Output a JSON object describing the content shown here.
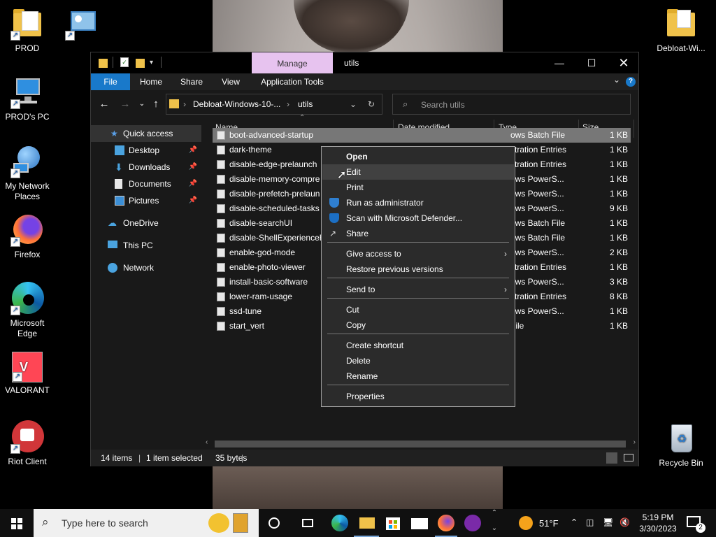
{
  "desktop": {
    "icons_left": [
      {
        "label": "PROD"
      },
      {
        "label": "PROD's PC"
      },
      {
        "label": "My Network Places"
      },
      {
        "label": "Firefox"
      },
      {
        "label": "Microsoft Edge"
      },
      {
        "label": "VALORANT"
      },
      {
        "label": "Riot Client"
      }
    ],
    "icons_right": [
      {
        "label": "Debloat-Wi..."
      },
      {
        "label": "Recycle Bin"
      }
    ]
  },
  "window": {
    "title": "utils",
    "manage_tab": "Manage",
    "ribbon_tabs": [
      "File",
      "Home",
      "Share",
      "View",
      "Application Tools"
    ],
    "help_label": "?",
    "address": {
      "segments": [
        "Debloat-Windows-10-...",
        "utils"
      ]
    },
    "search": {
      "placeholder": "Search utils"
    },
    "nav": {
      "quick_access": "Quick access",
      "items": [
        {
          "label": "Desktop",
          "pinned": true
        },
        {
          "label": "Downloads",
          "pinned": true
        },
        {
          "label": "Documents",
          "pinned": true
        },
        {
          "label": "Pictures",
          "pinned": true
        }
      ],
      "onedrive": "OneDrive",
      "thispc": "This PC",
      "network": "Network"
    },
    "columns": {
      "name": "Name",
      "date": "Date modified",
      "type": "Type",
      "size": "Size"
    },
    "files": [
      {
        "name": "boot-advanced-startup",
        "type": "ows Batch File",
        "size": "1 KB",
        "selected": true
      },
      {
        "name": "dark-theme",
        "type": "stration Entries",
        "size": "1 KB"
      },
      {
        "name": "disable-edge-prelaunch",
        "type": "stration Entries",
        "size": "1 KB"
      },
      {
        "name": "disable-memory-compre",
        "type": "ows PowerS...",
        "size": "1 KB"
      },
      {
        "name": "disable-prefetch-prelaun",
        "type": "ows PowerS...",
        "size": "1 KB"
      },
      {
        "name": "disable-scheduled-tasks",
        "type": "ows PowerS...",
        "size": "9 KB"
      },
      {
        "name": "disable-searchUI",
        "type": "ows Batch File",
        "size": "1 KB"
      },
      {
        "name": "disable-ShellExperienceH",
        "type": "ows Batch File",
        "size": "1 KB"
      },
      {
        "name": "enable-god-mode",
        "type": "ows PowerS...",
        "size": "2 KB"
      },
      {
        "name": "enable-photo-viewer",
        "type": "stration Entries",
        "size": "1 KB"
      },
      {
        "name": "install-basic-software",
        "type": "ows PowerS...",
        "size": "3 KB"
      },
      {
        "name": "lower-ram-usage",
        "type": "stration Entries",
        "size": "8 KB"
      },
      {
        "name": "ssd-tune",
        "type": "ows PowerS...",
        "size": "1 KB"
      },
      {
        "name": "start_vert",
        "type": "File",
        "size": "1 KB"
      }
    ],
    "status": {
      "items": "14 items",
      "selected": "1 item selected",
      "bytes": "35 bytes"
    }
  },
  "context_menu": {
    "items": [
      {
        "label": "Open",
        "bold": true
      },
      {
        "label": "Edit",
        "hover": true
      },
      {
        "label": "Print"
      },
      {
        "label": "Run as administrator",
        "icon": "shield-icon"
      },
      {
        "label": "Scan with Microsoft Defender...",
        "icon": "defender-icon"
      },
      {
        "label": "Share",
        "icon": "share-icon"
      },
      {
        "label": "Give access to",
        "submenu": true
      },
      {
        "label": "Restore previous versions"
      },
      {
        "label": "Send to",
        "submenu": true
      },
      {
        "label": "Cut"
      },
      {
        "label": "Copy"
      },
      {
        "label": "Create shortcut"
      },
      {
        "label": "Delete"
      },
      {
        "label": "Rename"
      },
      {
        "label": "Properties"
      }
    ]
  },
  "taskbar": {
    "search_placeholder": "Type here to search",
    "weather": "51°F",
    "time": "5:19 PM",
    "date": "3/30/2023",
    "notification_count": "2"
  },
  "colors": {
    "accent": "#1979ca",
    "manage_tab": "#e7c3ef"
  }
}
